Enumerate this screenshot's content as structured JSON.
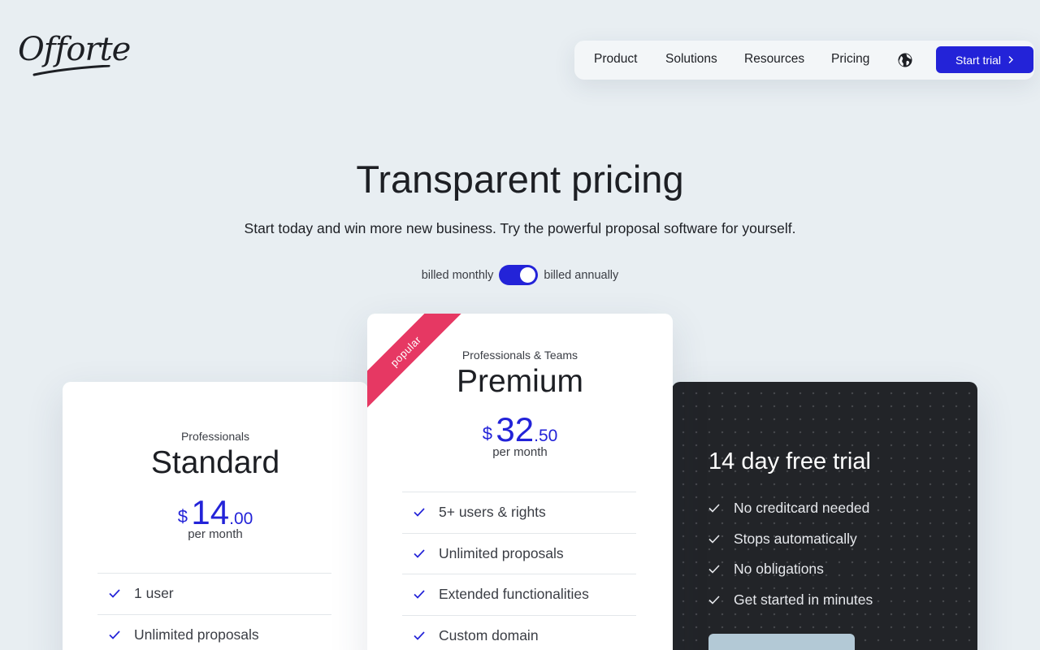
{
  "brand": {
    "name": "Offorte"
  },
  "nav": {
    "items": [
      "Product",
      "Solutions",
      "Resources",
      "Pricing"
    ],
    "globe_icon": "globe-icon",
    "cta_label": "Start trial"
  },
  "hero": {
    "title": "Transparent pricing",
    "subtitle": "Start today and win more new business. Try the powerful proposal software for yourself."
  },
  "billing": {
    "monthly_label": "billed monthly",
    "annually_label": "billed annually",
    "selected": "billed annually"
  },
  "plans": {
    "standard": {
      "tag": "Professionals",
      "name": "Standard",
      "currency": "$",
      "price_whole": "14",
      "price_cents": ".00",
      "period": "per month",
      "features": [
        "1 user",
        "Unlimited proposals"
      ]
    },
    "premium": {
      "ribbon": "popular",
      "tag": "Professionals & Teams",
      "name": "Premium",
      "currency": "$",
      "price_whole": "32",
      "price_cents": ".50",
      "period": "per month",
      "features": [
        "5+ users & rights",
        "Unlimited proposals",
        "Extended functionalities",
        "Custom domain"
      ]
    }
  },
  "trial": {
    "title": "14 day free trial",
    "items": [
      "No creditcard needed",
      "Stops automatically",
      "No obligations",
      "Get started in minutes"
    ]
  },
  "colors": {
    "accent": "#2323d8",
    "ribbon": "#e63863",
    "dark_card": "#222428",
    "background": "#e8eef2"
  }
}
